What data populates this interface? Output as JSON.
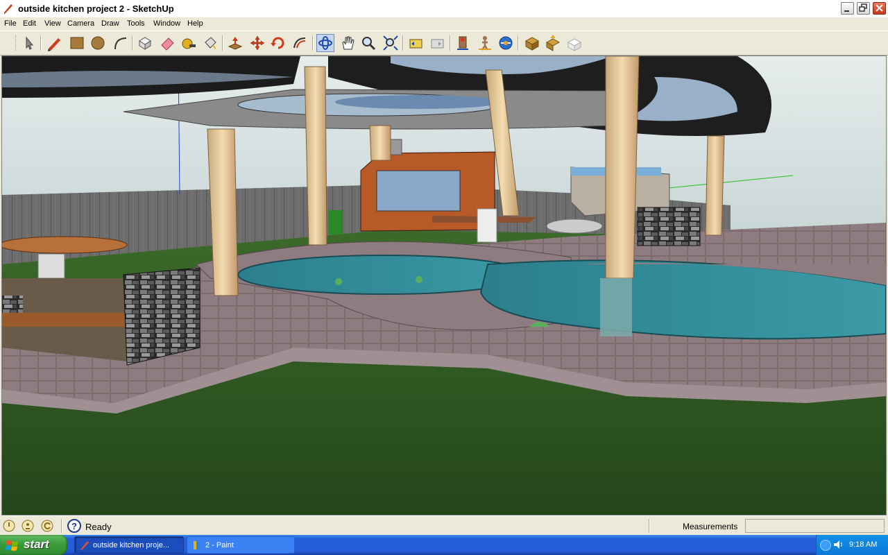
{
  "window": {
    "title": "outside kitchen project 2 - SketchUp",
    "controls": [
      "minimize",
      "restore",
      "close"
    ]
  },
  "menu": [
    "File",
    "Edit",
    "View",
    "Camera",
    "Draw",
    "Tools",
    "Window",
    "Help"
  ],
  "toolbar": {
    "tools": [
      {
        "name": "select-tool-icon"
      },
      {
        "name": "pencil-tool-icon"
      },
      {
        "name": "rectangle-tool-icon"
      },
      {
        "name": "circle-tool-icon"
      },
      {
        "name": "arc-tool-icon"
      },
      {
        "name": "make-component-icon"
      },
      {
        "name": "eraser-tool-icon"
      },
      {
        "name": "tape-measure-icon"
      },
      {
        "name": "paint-bucket-icon"
      },
      {
        "name": "push-pull-icon"
      },
      {
        "name": "move-tool-icon"
      },
      {
        "name": "rotate-tool-icon"
      },
      {
        "name": "follow-me-icon"
      },
      {
        "name": "orbit-tool-icon"
      },
      {
        "name": "pan-tool-icon"
      },
      {
        "name": "zoom-tool-icon"
      },
      {
        "name": "zoom-extents-icon"
      },
      {
        "name": "previous-view-icon"
      },
      {
        "name": "next-view-icon"
      },
      {
        "name": "position-camera-icon"
      },
      {
        "name": "walk-tool-icon"
      },
      {
        "name": "look-around-icon"
      },
      {
        "name": "get-models-icon"
      },
      {
        "name": "share-model-icon"
      },
      {
        "name": "share-component-icon"
      }
    ],
    "active_tool": "orbit-tool-icon"
  },
  "status": {
    "text": "Ready",
    "measurements_label": "Measurements",
    "measurements_value": ""
  },
  "taskbar": {
    "start_label": "start",
    "tasks": [
      {
        "label": "outside kitchen proje...",
        "active": true
      },
      {
        "label": "2 - Paint",
        "active": false
      }
    ],
    "clock": "9:18 AM"
  },
  "colors": {
    "sky": "#d8e4e4",
    "grass": "#2f5a22",
    "pool_water": "#2f8a96",
    "deck": "#4a3e3e",
    "canopy_dark": "#1c1c1c",
    "canopy_gray": "#8a8a8a",
    "taskbar_blue": "#245edb",
    "start_green": "#3a9a3a"
  }
}
